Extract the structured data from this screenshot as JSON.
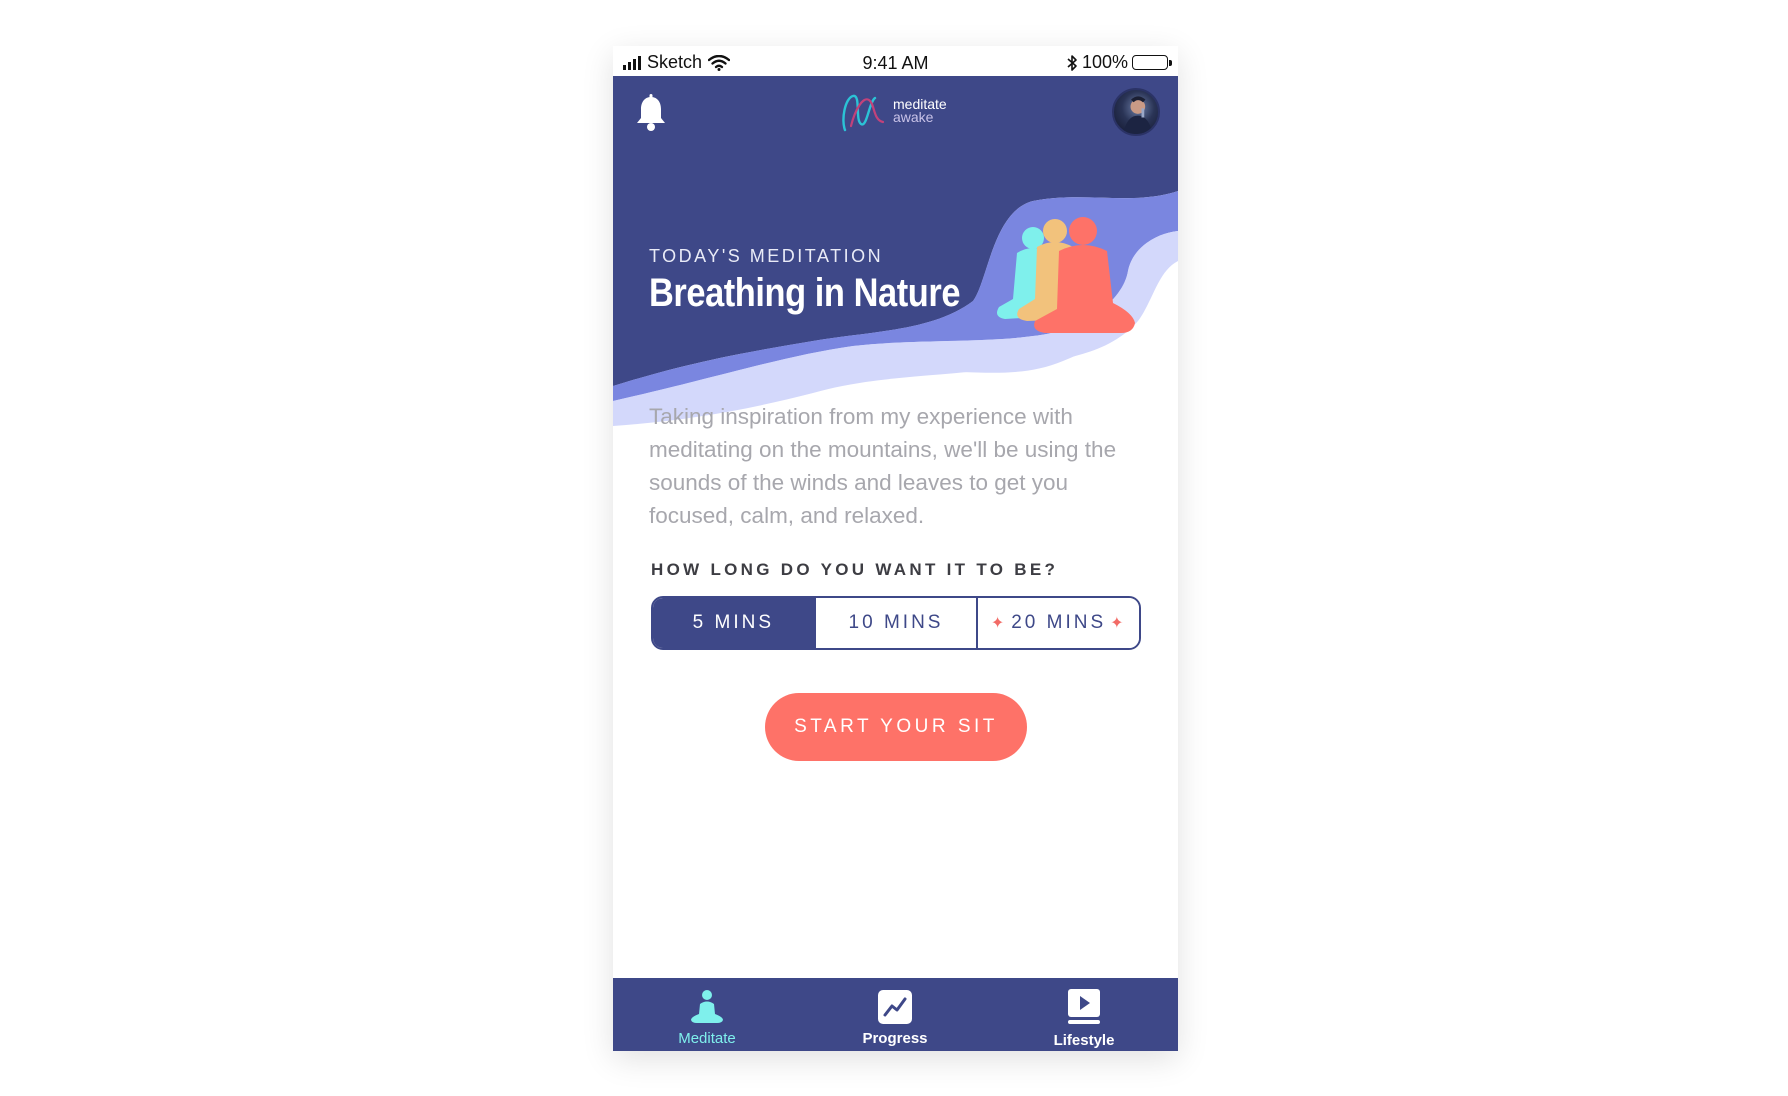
{
  "status_bar": {
    "carrier": "Sketch",
    "time": "9:41 AM",
    "battery": "100%"
  },
  "header": {
    "logo_line1": "meditate",
    "logo_line2": "awake"
  },
  "hero": {
    "eyebrow": "TODAY'S MEDITATION",
    "title": "Breathing in Nature"
  },
  "description": "Taking inspiration from my experience with meditating on the mountains, we'll be using the sounds of the winds and leaves to get you focused, calm, and relaxed.",
  "duration": {
    "question": "HOW LONG DO YOU WANT IT TO BE?",
    "options": [
      "5 MINS",
      "10 MINS",
      "20 MINS"
    ],
    "selected": "5 MINS"
  },
  "cta_label": "START YOUR SIT",
  "tabs": [
    {
      "label": "Meditate",
      "icon": "meditate-icon",
      "active": true
    },
    {
      "label": "Progress",
      "icon": "progress-chart-icon",
      "active": false
    },
    {
      "label": "Lifestyle",
      "icon": "play-video-icon",
      "active": false
    }
  ],
  "colors": {
    "primary": "#3e4888",
    "accent": "#fe7268",
    "active_tab": "#7ff0ec",
    "wave_mid": "#7a86e0",
    "wave_light": "#d3d8fb"
  }
}
